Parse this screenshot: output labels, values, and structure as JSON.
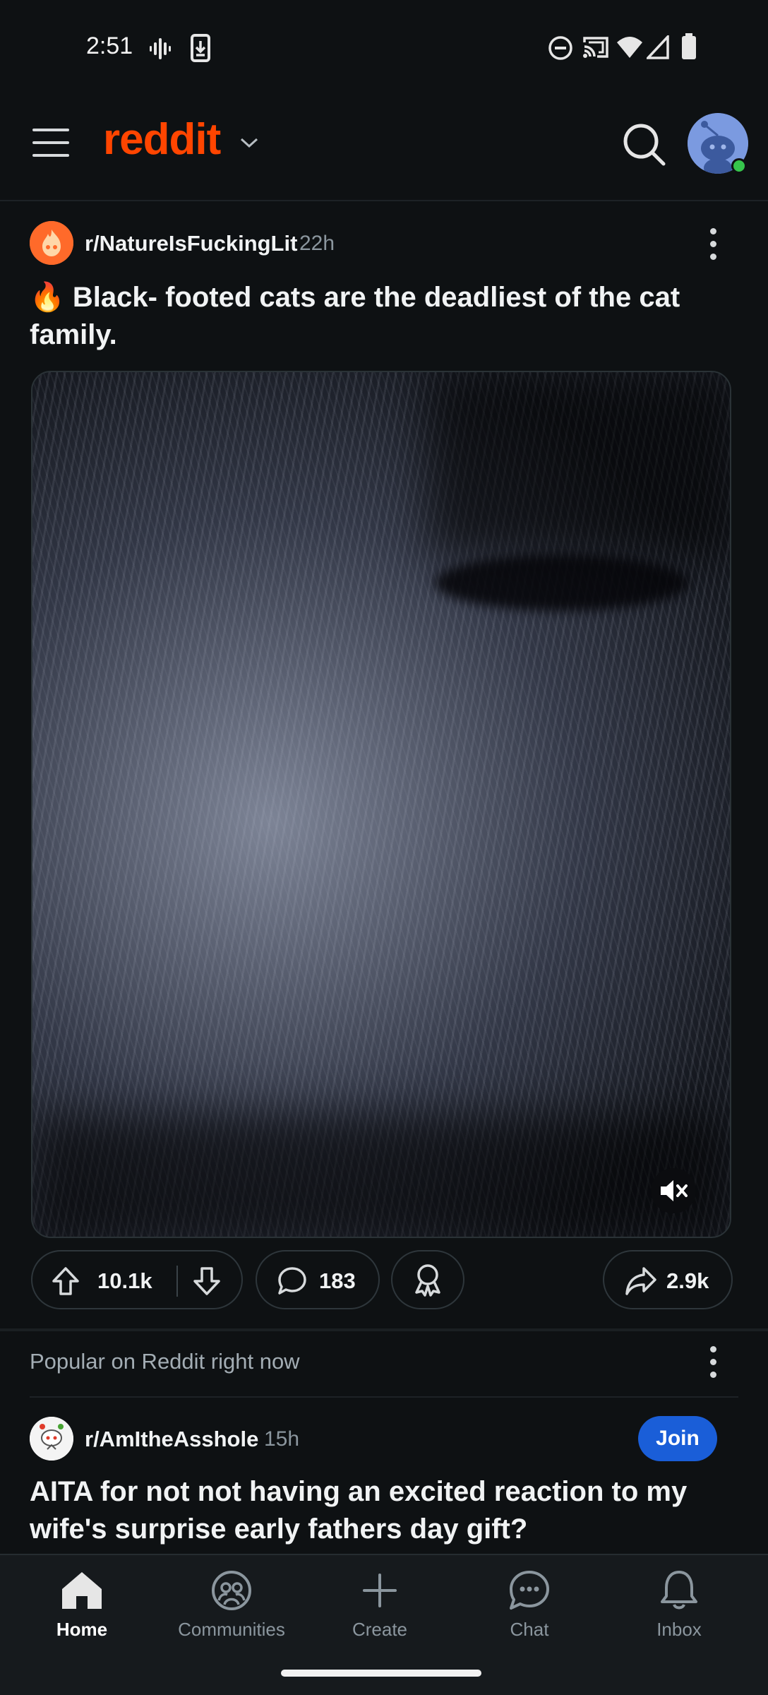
{
  "status_bar": {
    "time": "2:51",
    "left_icons": [
      "vibrate-icon",
      "download-icon"
    ],
    "right_icons": [
      "do-not-disturb-icon",
      "cast-icon",
      "wifi-icon",
      "signal-icon",
      "battery-icon"
    ]
  },
  "header": {
    "brand": "reddit",
    "icons": [
      "menu-icon",
      "chevron-down-icon",
      "search-icon",
      "avatar"
    ],
    "online_color": "#36c54c",
    "brand_color": "#ff4500"
  },
  "post": {
    "subreddit": "r/NatureIsFuckingLit",
    "age": "22h",
    "title": "🔥 Black- footed cats are the deadliest of the cat family.",
    "media_icon": "mute-icon",
    "upvotes": "10.1k",
    "comments": "183",
    "shares": "2.9k"
  },
  "popular": {
    "label": "Popular on Reddit right now",
    "subreddit": "r/AmItheAsshole",
    "age": "15h",
    "join_label": "Join",
    "join_color": "#1a5ed8",
    "title": "AITA for not not having an excited reaction to my wife's surprise early fathers day gift?"
  },
  "bottom_nav": {
    "items": [
      {
        "label": "Home",
        "icon": "home-icon",
        "active": true
      },
      {
        "label": "Communities",
        "icon": "communities-icon",
        "active": false
      },
      {
        "label": "Create",
        "icon": "plus-icon",
        "active": false
      },
      {
        "label": "Chat",
        "icon": "chat-icon",
        "active": false
      },
      {
        "label": "Inbox",
        "icon": "bell-icon",
        "active": false
      }
    ]
  }
}
